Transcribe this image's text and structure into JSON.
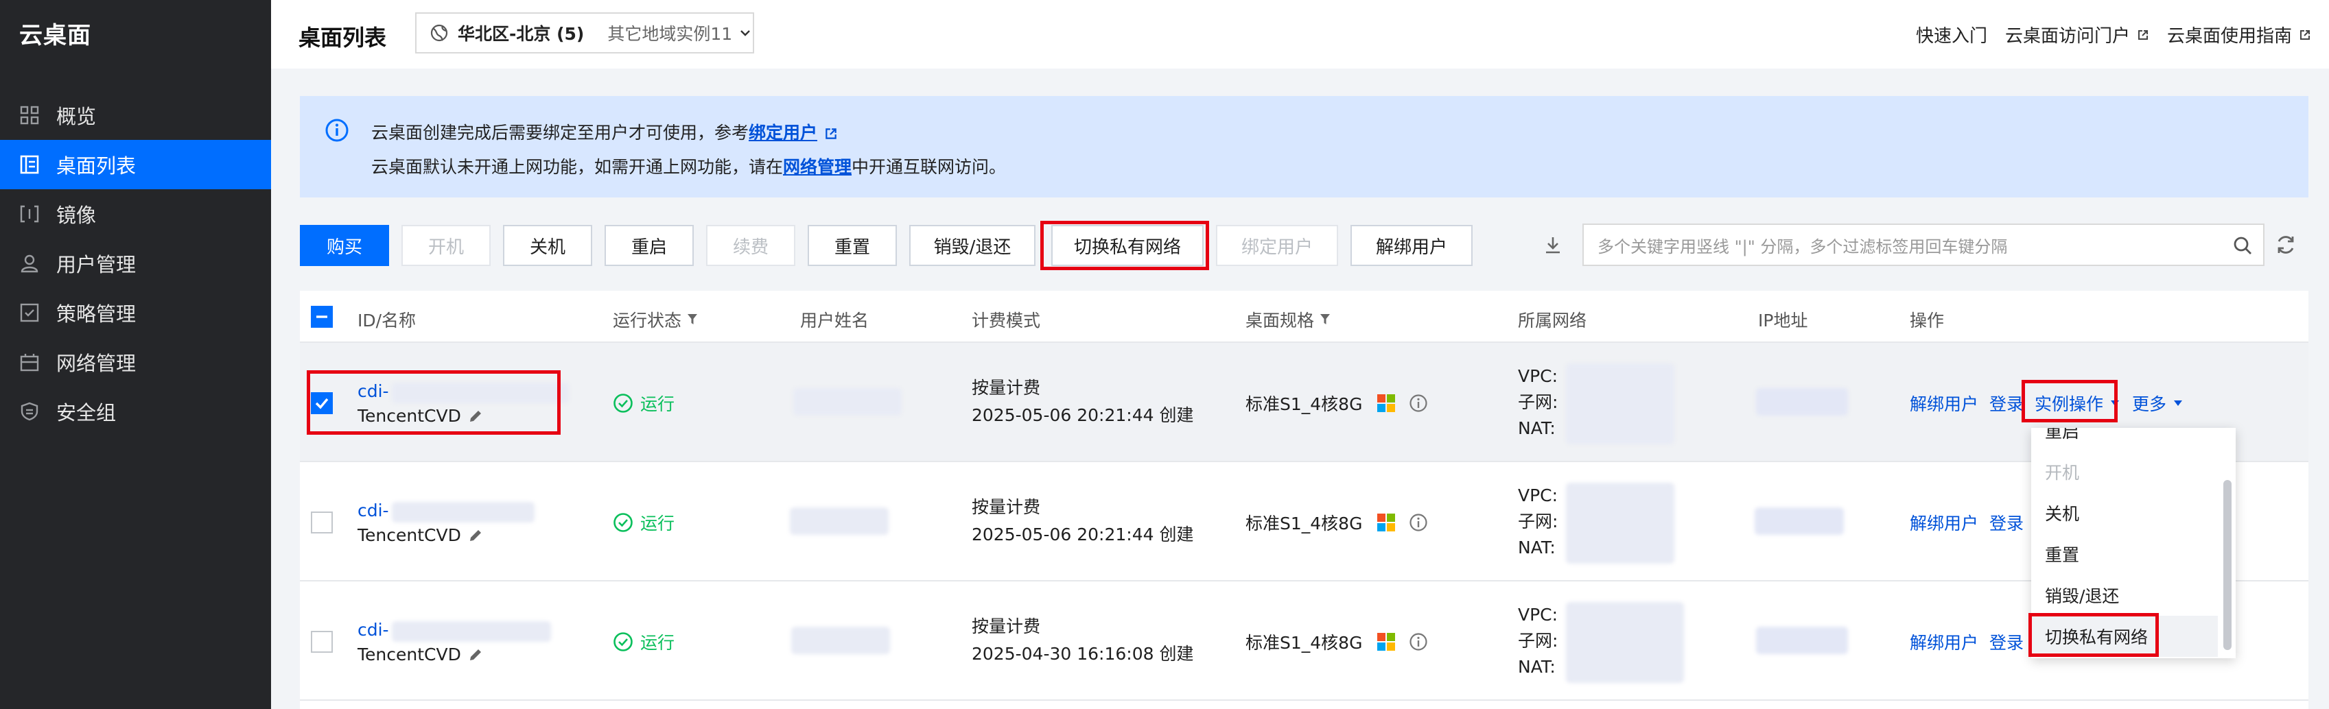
{
  "app": {
    "brand": "云桌面"
  },
  "sidebar": {
    "items": [
      {
        "label": "概览",
        "icon": "grid-icon",
        "active": false
      },
      {
        "label": "桌面列表",
        "icon": "list-icon",
        "active": true
      },
      {
        "label": "镜像",
        "icon": "image-icon",
        "active": false
      },
      {
        "label": "用户管理",
        "icon": "user-icon",
        "active": false
      },
      {
        "label": "策略管理",
        "icon": "policy-icon",
        "active": false
      },
      {
        "label": "网络管理",
        "icon": "network-icon",
        "active": false
      },
      {
        "label": "安全组",
        "icon": "shield-icon",
        "active": false
      }
    ]
  },
  "header": {
    "title": "桌面列表",
    "region_current": "华北区-北京 (5)",
    "region_other": "其它地域实例11",
    "links": [
      "快速入门",
      "云桌面访问门户",
      "云桌面使用指南"
    ]
  },
  "banner": {
    "line1_prefix": "云桌面创建完成后需要绑定至用户才可使用，参考",
    "line1_link": "绑定用户",
    "line2_prefix": "云桌面默认未开通上网功能，如需开通上网功能，请在",
    "line2_link": "网络管理",
    "line2_suffix": "中开通互联网访问。"
  },
  "toolbar": {
    "buy": "购买",
    "power_on": "开机",
    "power_off": "关机",
    "restart": "重启",
    "renew": "续费",
    "reset": "重置",
    "destroy": "销毁/退还",
    "switch_network": "切换私有网络",
    "bind_user": "绑定用户",
    "unbind_user": "解绑用户",
    "search_placeholder": "多个关键字用竖线 \"|\" 分隔，多个过滤标签用回车键分隔"
  },
  "table": {
    "columns": [
      "ID/名称",
      "运行状态",
      "用户姓名",
      "计费模式",
      "桌面规格",
      "所属网络",
      "IP地址",
      "操作"
    ],
    "rows": [
      {
        "id": "cdi-",
        "name": "TencentCVD",
        "status": "运行",
        "billing": "按量计费",
        "created": "2025-05-06 20:21:44 创建",
        "spec": "标准S1_4核8G",
        "selected": true
      },
      {
        "id": "cdi-",
        "name": "TencentCVD",
        "status": "运行",
        "billing": "按量计费",
        "created": "2025-05-06 20:21:44 创建",
        "spec": "标准S1_4核8G",
        "selected": false
      },
      {
        "id": "cdi-",
        "name": "TencentCVD",
        "status": "运行",
        "billing": "按量计费",
        "created": "2025-04-30 16:16:08 创建",
        "spec": "标准S1_4核8G",
        "selected": false
      }
    ],
    "net_labels": {
      "vpc": "VPC:",
      "subnet": "子网:",
      "nat": "NAT:"
    },
    "actions": {
      "unbind": "解绑用户",
      "login": "登录",
      "instance_ops": "实例操作",
      "more": "更多"
    }
  },
  "dropdown": {
    "items": [
      {
        "label": "重启",
        "disabled": false
      },
      {
        "label": "开机",
        "disabled": true
      },
      {
        "label": "关机",
        "disabled": false
      },
      {
        "label": "重置",
        "disabled": false
      },
      {
        "label": "销毁/退还",
        "disabled": false
      },
      {
        "label": "切换私有网络",
        "disabled": false
      }
    ]
  },
  "colors": {
    "accent": "#006eff",
    "link": "#0052d9",
    "running": "#0abf5b",
    "highlight": "#e60012",
    "sidebar_bg": "#252629",
    "banner_bg": "#d8e7ff"
  }
}
